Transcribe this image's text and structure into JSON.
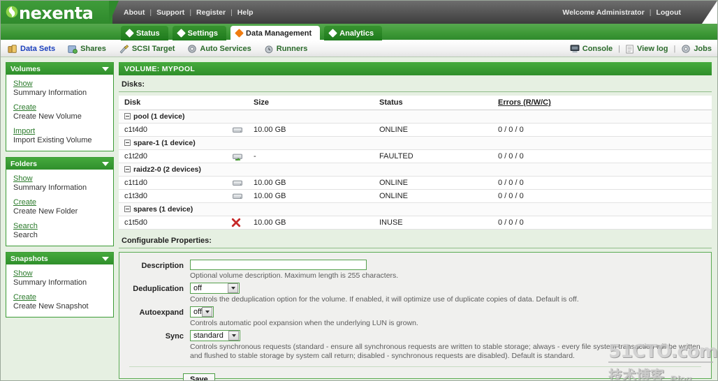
{
  "header": {
    "brand": "nexenta",
    "brand_icon": "nexenta-spiral-logo",
    "links": [
      {
        "label": "About"
      },
      {
        "label": "Support"
      },
      {
        "label": "Register"
      },
      {
        "label": "Help"
      }
    ],
    "welcome": "Welcome Administrator",
    "logout": "Logout",
    "separator": "|"
  },
  "tabs": [
    {
      "label": "Status",
      "active": false
    },
    {
      "label": "Settings",
      "active": false
    },
    {
      "label": "Data Management",
      "active": true
    },
    {
      "label": "Analytics",
      "active": false
    }
  ],
  "subnav": {
    "left": [
      {
        "label": "Data Sets",
        "icon": "data-sets-icon",
        "active": true
      },
      {
        "label": "Shares",
        "icon": "shares-icon",
        "active": false
      },
      {
        "label": "SCSI Target",
        "icon": "scsi-target-icon",
        "active": false
      },
      {
        "label": "Auto Services",
        "icon": "auto-services-icon",
        "active": false
      },
      {
        "label": "Runners",
        "icon": "runners-icon",
        "active": false
      }
    ],
    "right": [
      {
        "label": "Console",
        "icon": "console-icon"
      },
      {
        "label": "View log",
        "icon": "view-log-icon"
      },
      {
        "label": "Jobs",
        "icon": "jobs-icon"
      }
    ],
    "separator": "|"
  },
  "sidebar": {
    "panels": [
      {
        "title": "Volumes",
        "items": [
          {
            "link": "Show",
            "desc": "Summary Information"
          },
          {
            "link": "Create",
            "desc": "Create New Volume"
          },
          {
            "link": "Import",
            "desc": "Import Existing Volume"
          }
        ]
      },
      {
        "title": "Folders",
        "items": [
          {
            "link": "Show",
            "desc": "Summary Information"
          },
          {
            "link": "Create",
            "desc": "Create New Folder"
          },
          {
            "link": "Search",
            "desc": "Search"
          }
        ]
      },
      {
        "title": "Snapshots",
        "items": [
          {
            "link": "Show",
            "desc": "Summary Information"
          },
          {
            "link": "Create",
            "desc": "Create New Snapshot"
          }
        ]
      }
    ]
  },
  "main": {
    "volume_bar": "VOLUME: MYPOOL",
    "disks_label": "Disks:",
    "table": {
      "columns": [
        "Disk",
        "Size",
        "Status",
        "Errors (R/W/C)"
      ],
      "rows": [
        {
          "type": "group",
          "label": "pool (1 device)"
        },
        {
          "type": "disk",
          "disk": "c1t4d0",
          "icon": "disk-icon",
          "size": "10.00 GB",
          "status": "ONLINE",
          "errors": "0 / 0 / 0"
        },
        {
          "type": "group",
          "label": "spare-1 (1 device)"
        },
        {
          "type": "disk",
          "disk": "c1t2d0",
          "icon": "disk-spare-arrow-icon",
          "size": "-",
          "status": "FAULTED",
          "errors": "0 / 0 / 0"
        },
        {
          "type": "group",
          "label": "raidz2-0 (2 devices)"
        },
        {
          "type": "disk",
          "disk": "c1t1d0",
          "icon": "disk-icon",
          "size": "10.00 GB",
          "status": "ONLINE",
          "errors": "0 / 0 / 0"
        },
        {
          "type": "disk",
          "disk": "c1t3d0",
          "icon": "disk-icon",
          "size": "10.00 GB",
          "status": "ONLINE",
          "errors": "0 / 0 / 0"
        },
        {
          "type": "group",
          "label": "spares (1 device)"
        },
        {
          "type": "disk",
          "disk": "c1t5d0",
          "icon": "red-x-icon",
          "size": "10.00 GB",
          "status": "INUSE",
          "errors": "0 / 0 / 0"
        }
      ]
    },
    "config": {
      "label": "Configurable Properties:",
      "fields": [
        {
          "label": "Description",
          "control": "text",
          "value": "",
          "placeholder": "",
          "help": "Optional volume description. Maximum length is 255 characters."
        },
        {
          "label": "Deduplication",
          "control": "select",
          "value": "off",
          "help": "Controls the deduplication option for the volume. If enabled, it will optimize use of duplicate copies of data. Default is off."
        },
        {
          "label": "Autoexpand",
          "control": "select",
          "value": "off",
          "help": "Controls automatic pool expansion when the underlying LUN is grown."
        },
        {
          "label": "Sync",
          "control": "select",
          "value": "standard",
          "help": "Controls synchronous requests (standard - ensure all synchronous requests are written to stable storage; always - every file system transaction will be written and flushed to stable storage by system call return; disabled - synchronous requests are disabled). Default is standard."
        }
      ],
      "save_label": "Save"
    }
  },
  "watermark": {
    "top": "51CTO.com",
    "bottom_cn": "技术博客",
    "bottom_en": "Blog"
  },
  "colors": {
    "brand_green": "#2f8a2c",
    "tab_green": "#1e7a1c",
    "accent_orange": "#f07c10",
    "link_green": "#2a7a2a",
    "active_blue": "#1a3fbd",
    "page_bg": "#e6f0e2"
  }
}
